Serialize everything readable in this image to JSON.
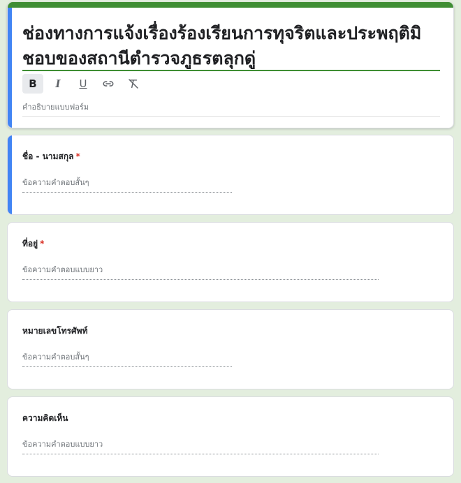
{
  "form": {
    "title": "ช่องทางการแจ้งเรื่องร้องเรียนการทุจริตและประพฤติมิชอบของสถานีตำรวจภูธรตลุกดู่",
    "description_placeholder": "คำอธิบายแบบฟอร์ม",
    "toolbar": {
      "bold": "B",
      "italic": "I",
      "underline": "U"
    }
  },
  "questions": [
    {
      "label": "ชื่อ - นามสกุล",
      "required": "*",
      "placeholder": "ข้อความคำตอบสั้นๆ"
    },
    {
      "label": "ที่อยู่",
      "required": "*",
      "placeholder": "ข้อความคำตอบแบบยาว"
    },
    {
      "label": "หมายเลขโทรศัพท์",
      "placeholder": "ข้อความคำตอบสั้นๆ"
    },
    {
      "label": "ความคิดเห็น",
      "placeholder": "ข้อความคำตอบแบบยาว"
    }
  ],
  "colors": {
    "theme_green": "#3f8e33",
    "active_blue": "#4285f4",
    "background": "#e3eede",
    "required_red": "#d93025"
  },
  "icons": [
    "bold-icon",
    "italic-icon",
    "underline-icon",
    "link-icon",
    "clear-format-icon"
  ]
}
